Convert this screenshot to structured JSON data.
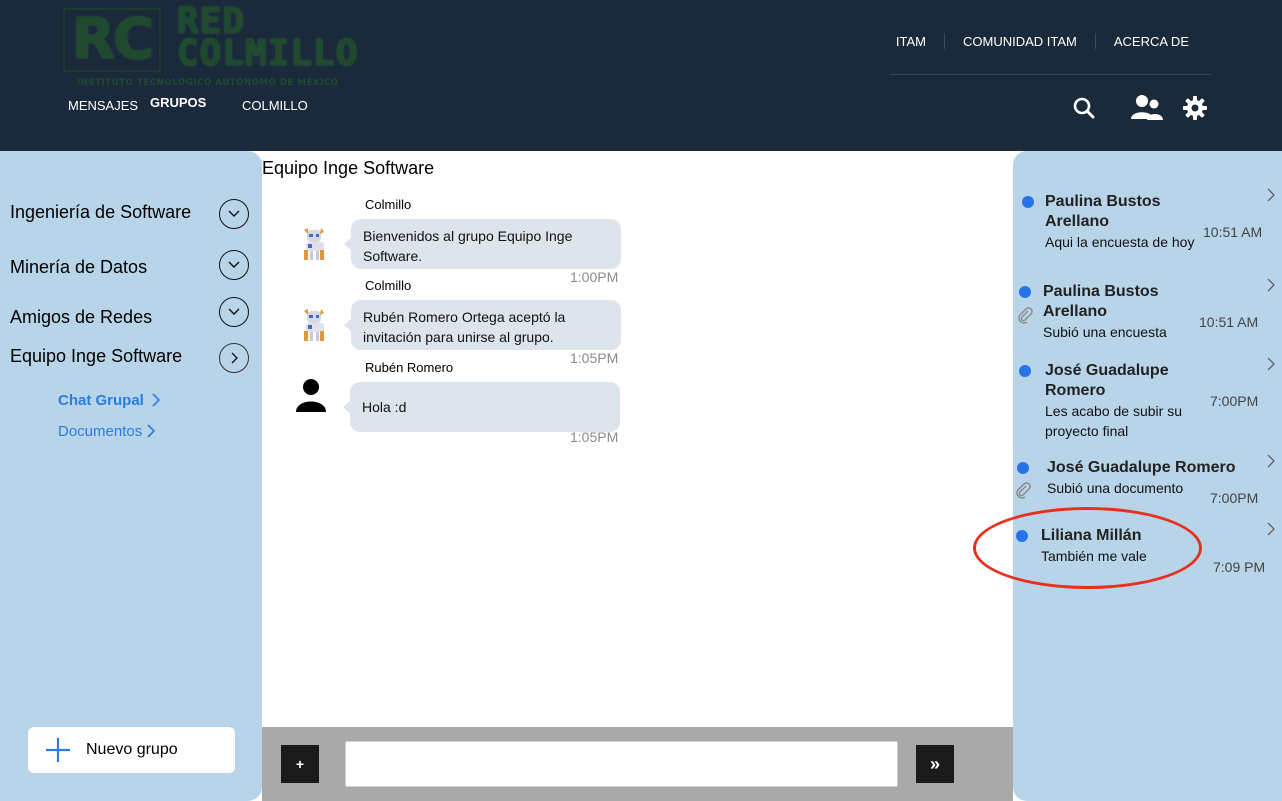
{
  "header": {
    "logo": {
      "initials": "RC",
      "name": "RED\nCOLMILLO",
      "subtitle": "INSTITUTO TECNOLÓGICO AUTÓNOMO DE MÉXICO"
    },
    "top_links": [
      "ITAM",
      "COMUNIDAD ITAM",
      "ACERCA DE"
    ],
    "tabs": [
      {
        "label": "MENSAJES",
        "active": false
      },
      {
        "label": "GRUPOS",
        "active": true
      },
      {
        "label": "COLMILLO",
        "active": false
      }
    ],
    "icons": [
      "search-icon",
      "users-icon",
      "gear-icon"
    ]
  },
  "groups": {
    "items": [
      {
        "label": "Ingeniería de Software",
        "expanded": false
      },
      {
        "label": "Minería de Datos",
        "expanded": false
      },
      {
        "label": "Amigos de Redes",
        "expanded": false
      },
      {
        "label": "Equipo Inge Software",
        "expanded": true
      }
    ],
    "subitems": [
      {
        "label": "Chat Grupal",
        "active": true
      },
      {
        "label": "Documentos",
        "active": false
      }
    ],
    "new_group_label": "Nuevo grupo"
  },
  "chat": {
    "title": "Equipo Inge Software",
    "messages": [
      {
        "sender": "Colmillo",
        "text": "Bienvenidos al grupo Equipo Inge Software.",
        "time": "1:00PM",
        "avatar": "robot-dog-icon"
      },
      {
        "sender": "Colmillo",
        "text": "Rubén Romero Ortega aceptó la invitación para unirse al grupo.",
        "time": "1:05PM",
        "avatar": "robot-dog-icon"
      },
      {
        "sender": "Rubén Romero",
        "text": "Hola :d",
        "time": "1:05PM",
        "avatar": "person-icon"
      }
    ],
    "composer": {
      "attach_label": "+",
      "send_label": "»",
      "input_value": ""
    }
  },
  "notifications": [
    {
      "name": "Paulina Bustos Arellano",
      "text": "Aqui la encuesta de hoy",
      "time": "10:51 AM",
      "attachment": false
    },
    {
      "name": "Paulina Bustos Arellano",
      "text": "Subió una encuesta",
      "time": "10:51 AM",
      "attachment": true
    },
    {
      "name": "José Guadalupe Romero",
      "text": "Les acabo de subir su proyecto final",
      "time": "7:00PM",
      "attachment": false
    },
    {
      "name": "José Guadalupe Romero",
      "text": "Subió una documento",
      "time": "7:00PM",
      "attachment": true
    },
    {
      "name": "Liliana Millán",
      "text": "También me vale",
      "time": "7:09 PM",
      "attachment": false,
      "highlighted": true
    }
  ],
  "colors": {
    "header_bg": "#1b2a3a",
    "sidebar_bg": "#b8d4e9",
    "accent_blue": "#2a7de1",
    "dot_blue": "#2673e8",
    "bubble_bg": "#dde4ec",
    "highlight_red": "#e8301f",
    "composer_bg": "#a9a9a9"
  }
}
